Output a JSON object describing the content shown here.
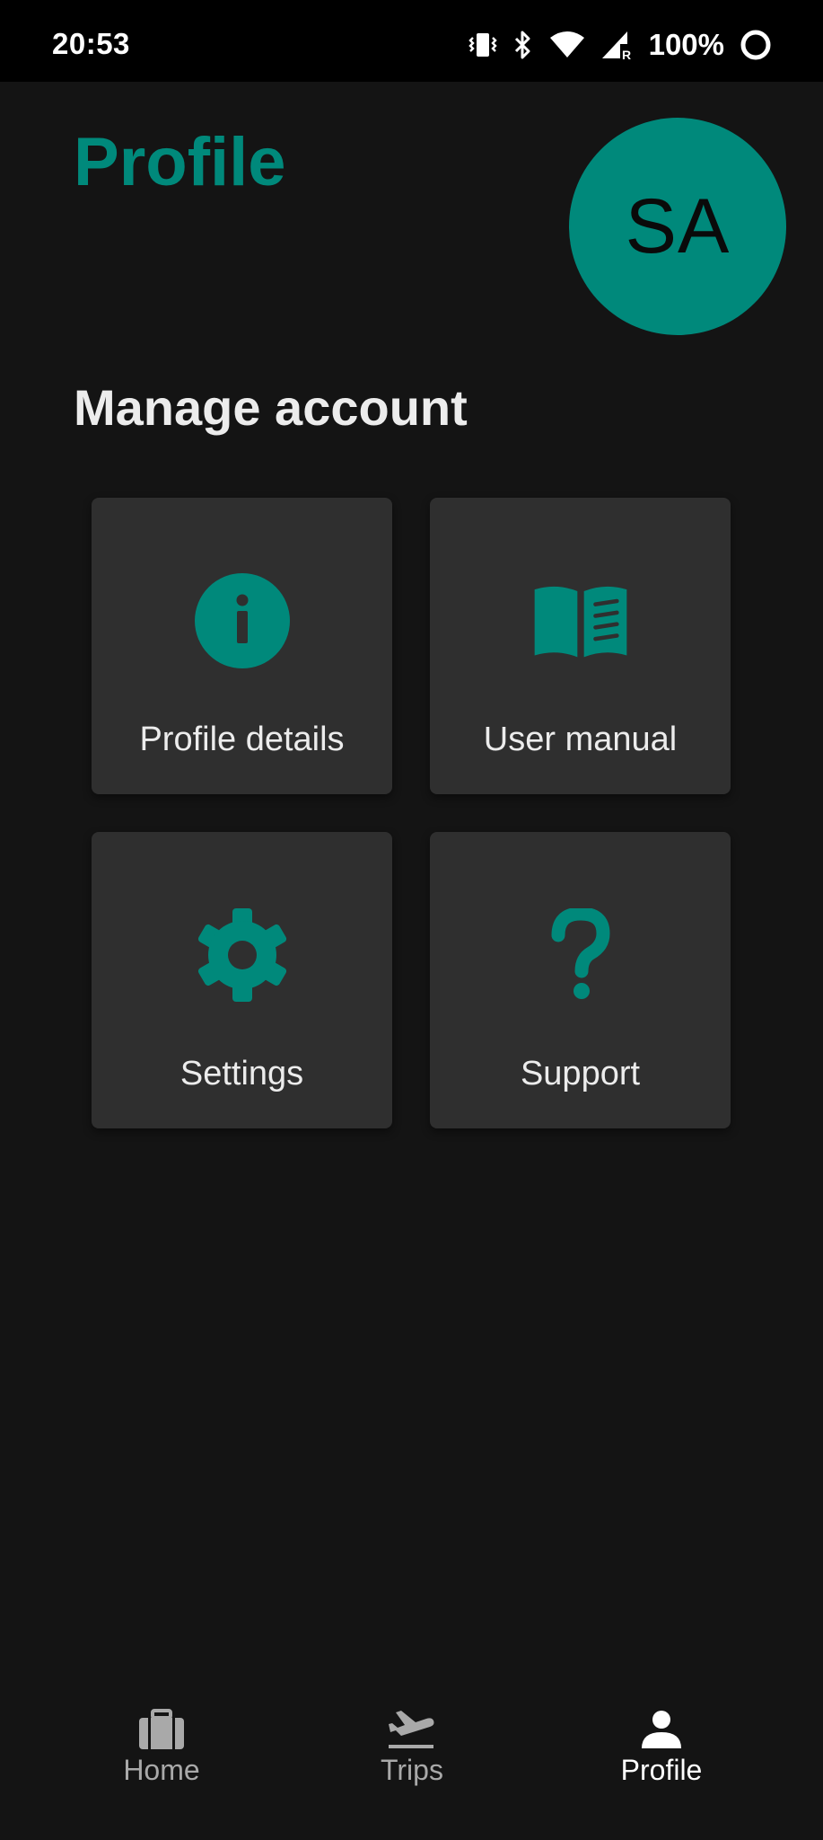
{
  "status_bar": {
    "time": "20:53",
    "battery": "100%",
    "icons": [
      "vibrate-icon",
      "bluetooth-icon",
      "wifi-icon",
      "signal-roaming-icon",
      "battery-ring-icon"
    ]
  },
  "header": {
    "title": "Profile",
    "avatar_initials": "SA"
  },
  "section": {
    "title": "Manage account"
  },
  "cards": [
    {
      "label": "Profile details",
      "icon": "info-icon"
    },
    {
      "label": "User manual",
      "icon": "book-icon"
    },
    {
      "label": "Settings",
      "icon": "gear-icon"
    },
    {
      "label": "Support",
      "icon": "question-icon"
    }
  ],
  "bottom_nav": {
    "items": [
      {
        "label": "Home",
        "icon": "briefcase-icon",
        "active": false
      },
      {
        "label": "Trips",
        "icon": "plane-departure-icon",
        "active": false
      },
      {
        "label": "Profile",
        "icon": "person-icon",
        "active": true
      }
    ]
  },
  "colors": {
    "accent": "#00897b",
    "background": "#141414",
    "card": "#2f2f2f",
    "status_bar": "#000000"
  }
}
